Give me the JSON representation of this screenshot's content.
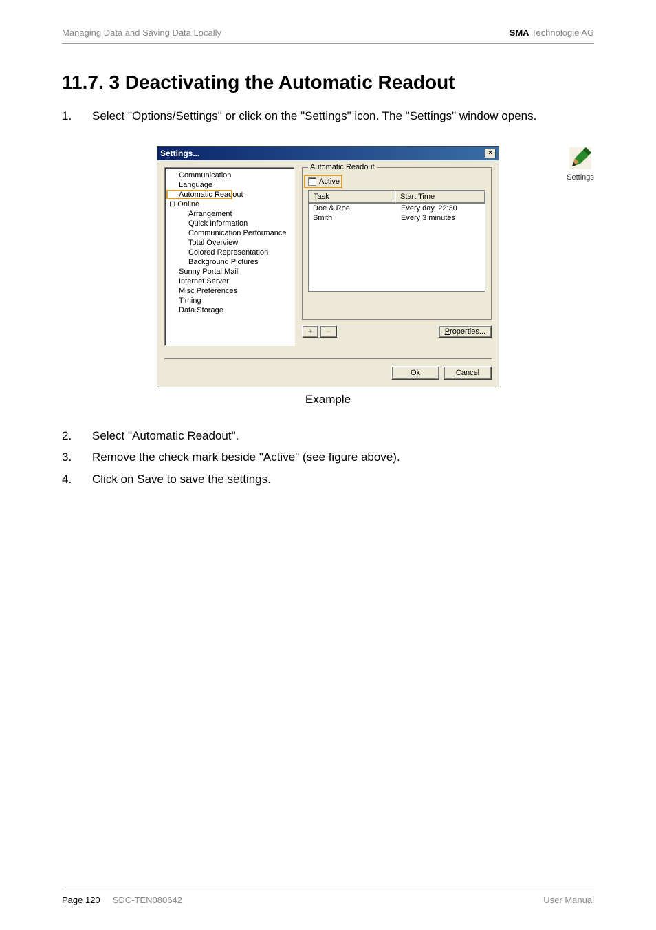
{
  "header": {
    "left": "Managing Data and Saving Data Locally",
    "right_bold": "SMA",
    "right_rest": " Technologie AG"
  },
  "section_title": "11.7. 3 Deactivating the Automatic Readout",
  "steps": {
    "s1_num": "1.",
    "s1_text": "Select \"Options/Settings\" or click on the \"Settings\" icon. The \"Settings\" window opens.",
    "s2_num": "2.",
    "s2_text": "Select \"Automatic Readout\".",
    "s3_num": "3.",
    "s3_text": "Remove the check mark beside \"Active\" (see figure above).",
    "s4_num": "4.",
    "s4_text": "Click on Save to save the settings."
  },
  "settings_icon_label": "Settings",
  "caption": "Example",
  "dialog": {
    "title": "Settings...",
    "close_x": "×",
    "tree": {
      "communication": "Communication",
      "language": "Language",
      "automatic_readout": "Automatic Readout",
      "online": "Online",
      "arrangement": "Arrangement",
      "quick_information": "Quick Information",
      "comm_perf": "Communication Performance",
      "total_overview": "Total Overview",
      "colored_repr": "Colored Representation",
      "background_pics": "Background Pictures",
      "sunny_portal_mail": "Sunny Portal Mail",
      "internet_server": "Internet Server",
      "misc_prefs": "Misc Preferences",
      "timing": "Timing",
      "data_storage": "Data Storage"
    },
    "group_legend": "Automatic Readout",
    "active_label": "Active",
    "col_task": "Task",
    "col_start": "Start Time",
    "rows": [
      {
        "task": "Doe & Roe",
        "time": "Every day, 22:30"
      },
      {
        "task": "Smith",
        "time": "Every 3 minutes"
      }
    ],
    "btn_plus": "+",
    "btn_minus": "–",
    "btn_properties": "Properties...",
    "btn_ok": "Ok",
    "btn_cancel": "Cancel"
  },
  "footer": {
    "page_label": "Page 120",
    "doc_code": "SDC-TEN080642",
    "right": "User Manual"
  }
}
